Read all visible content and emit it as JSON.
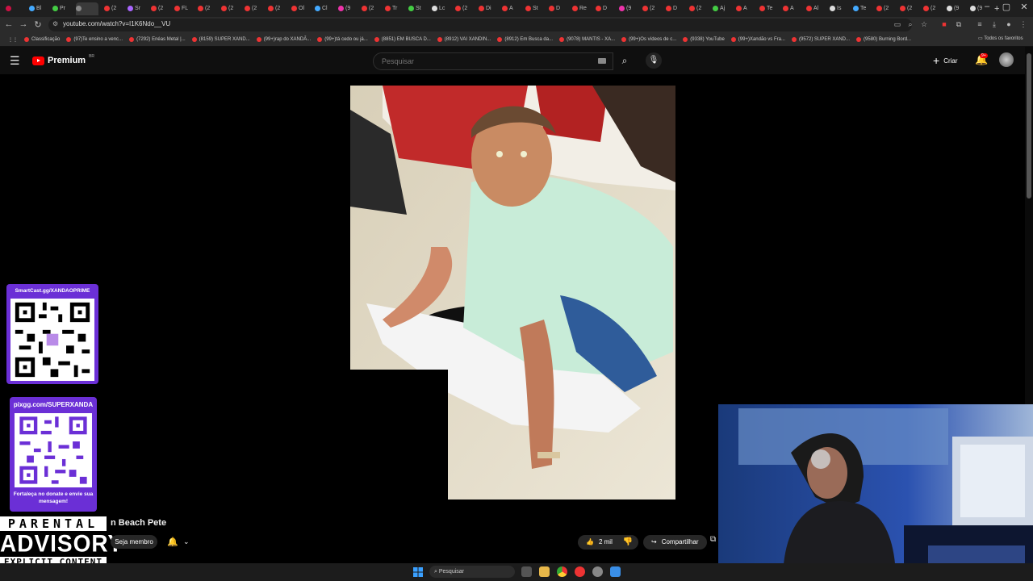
{
  "browser": {
    "tabs": [
      {
        "label": "",
        "color": "#c14"
      },
      {
        "label": "Bl",
        "color": "#4af"
      },
      {
        "label": "Pr",
        "color": "#4c4"
      },
      {
        "label": "",
        "color": "#888"
      },
      {
        "label": "(2",
        "color": "#e33"
      },
      {
        "label": "Sr",
        "color": "#a6f"
      },
      {
        "label": "(2",
        "color": "#e33"
      },
      {
        "label": "FL",
        "color": "#e33"
      },
      {
        "label": "(2",
        "color": "#e33"
      },
      {
        "label": "(2",
        "color": "#e33"
      },
      {
        "label": "(2",
        "color": "#e33"
      },
      {
        "label": "(2",
        "color": "#e33"
      },
      {
        "label": "Ol",
        "color": "#e33"
      },
      {
        "label": "Cl",
        "color": "#4af"
      },
      {
        "label": "(9",
        "color": "#e3a"
      },
      {
        "label": "(2",
        "color": "#e33"
      },
      {
        "label": "Tr",
        "color": "#e33"
      },
      {
        "label": "St",
        "color": "#4c4"
      },
      {
        "label": "Lc",
        "color": "#ddd"
      },
      {
        "label": "(2",
        "color": "#e33"
      },
      {
        "label": "Di",
        "color": "#e33"
      },
      {
        "label": "A",
        "color": "#e33"
      },
      {
        "label": "St",
        "color": "#e33"
      },
      {
        "label": "D",
        "color": "#e33"
      },
      {
        "label": "Re",
        "color": "#e33"
      },
      {
        "label": "D",
        "color": "#e33"
      },
      {
        "label": "(9",
        "color": "#e3a"
      },
      {
        "label": "(2",
        "color": "#e33"
      },
      {
        "label": "D",
        "color": "#e33"
      },
      {
        "label": "(2",
        "color": "#e33"
      },
      {
        "label": "Aj",
        "color": "#4c4"
      },
      {
        "label": "A",
        "color": "#e33"
      },
      {
        "label": "Te",
        "color": "#e33"
      },
      {
        "label": "A",
        "color": "#e33"
      },
      {
        "label": "Al",
        "color": "#e33"
      },
      {
        "label": "Is",
        "color": "#ddd"
      },
      {
        "label": "Te",
        "color": "#4af"
      },
      {
        "label": "(2",
        "color": "#e33"
      },
      {
        "label": "(2",
        "color": "#e33"
      },
      {
        "label": "(2",
        "color": "#e33"
      },
      {
        "label": "(9",
        "color": "#ddd"
      },
      {
        "label": "(9",
        "color": "#ddd"
      }
    ],
    "new_tab": "+",
    "url": "youtube.com/watch?v=I1K6Ndo__VU",
    "bookmarks": [
      "Classificação",
      "(97)Te ensino a venc...",
      "(7292) Enéas Metal |...",
      "(8159) SUPER XAND...",
      "(99+)rap do XANDÃ...",
      "(99+)tá cedo ou já...",
      "(8851) EM BUSCA D...",
      "(8912) VAI XANDIN...",
      "(8912) Em Busca da...",
      "(9078) MANTIS - XA...",
      "(99+)Os vídeos de c...",
      "(9338) YouTube",
      "(99+)Xandão vs Fra...",
      "(9572) SUPER XAND...",
      "(9580) Burning Bord..."
    ],
    "all_bookmarks": "Todos os favoritos"
  },
  "youtube": {
    "logo_text": "Premium",
    "logo_region": "BR",
    "search_placeholder": "Pesquisar",
    "create_label": "Criar",
    "notification_count": "9+"
  },
  "overlays": {
    "qr1_title": "SmartCast.gg/XANDAOPRIME",
    "qr2_title": "pixgg.com/SUPERXANDA",
    "qr2_caption": "Fortaleça no donate e envie sua mensagem!",
    "advisory_top": "PARENTAL",
    "advisory_mid": "ADVISORY",
    "advisory_bot": "EXPLICIT CONTENT"
  },
  "video": {
    "title_visible": "n Beach Pete",
    "join_label": "Seja membro",
    "likes": "2 mil",
    "share_label": "Compartilhar"
  },
  "taskbar": {
    "search_label": "Pesquisar"
  }
}
